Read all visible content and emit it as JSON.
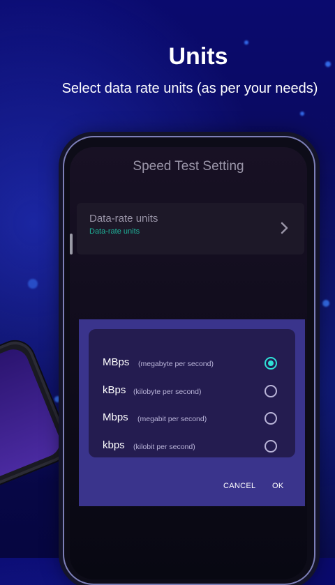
{
  "header": {
    "title": "Units",
    "subtitle": "Select data rate units (as per your needs)"
  },
  "app": {
    "title": "Speed Test Setting",
    "setting": {
      "title": "Data-rate units",
      "subtitle": "Data-rate units",
      "icon": "chevron-right-icon"
    }
  },
  "dialog": {
    "options": [
      {
        "label": "MBps",
        "desc": "(megabyte per second)",
        "selected": true
      },
      {
        "label": "kBps",
        "desc": "(kilobyte per second)",
        "selected": false
      },
      {
        "label": "Mbps",
        "desc": "(megabit per second)",
        "selected": false
      },
      {
        "label": "kbps",
        "desc": "(kilobit per second)",
        "selected": false
      }
    ],
    "cancel_label": "CANCEL",
    "ok_label": "OK"
  },
  "colors": {
    "accent": "#2fe0d6",
    "dialog_bg": "#3a348c",
    "card_bg": "#241c50",
    "subtitle_green": "#1fb39a"
  }
}
